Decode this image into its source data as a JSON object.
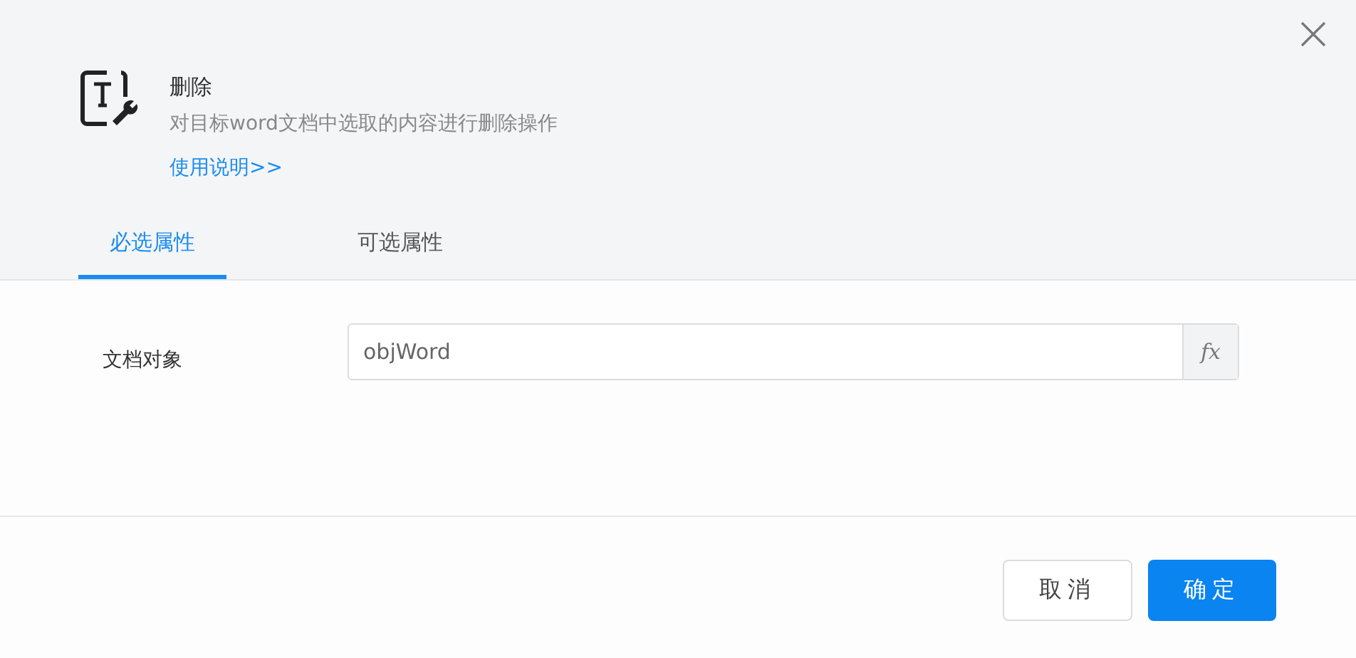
{
  "dialog": {
    "title": "删除",
    "description": "对目标word文档中选取的内容进行删除操作",
    "help_link": "使用说明>>"
  },
  "tabs": [
    {
      "label": "必选属性",
      "selected": true
    },
    {
      "label": "可选属性",
      "selected": false
    }
  ],
  "fields": [
    {
      "label": "文档对象",
      "value": "objWord",
      "button": "fx"
    }
  ],
  "buttons": [
    {
      "label": "取消",
      "kind": "secondary"
    },
    {
      "label": "确定",
      "kind": "primary"
    }
  ]
}
